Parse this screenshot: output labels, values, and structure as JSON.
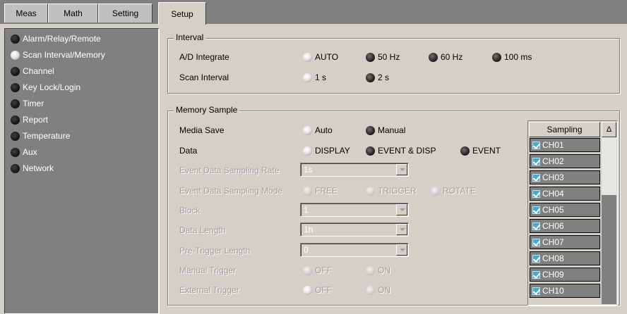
{
  "tabs": [
    {
      "label": "Meas"
    },
    {
      "label": "Math"
    },
    {
      "label": "Setting"
    },
    {
      "label": "Setup",
      "active": true
    }
  ],
  "nav": {
    "items": [
      {
        "label": "Alarm/Relay/Remote",
        "selected": false
      },
      {
        "label": "Scan Interval/Memory",
        "selected": true
      },
      {
        "label": "Channel",
        "selected": false
      },
      {
        "label": "Key Lock/Login",
        "selected": false
      },
      {
        "label": "Timer",
        "selected": false
      },
      {
        "label": "Report",
        "selected": false
      },
      {
        "label": "Temperature",
        "selected": false
      },
      {
        "label": "Aux",
        "selected": false
      },
      {
        "label": "Network",
        "selected": false
      }
    ]
  },
  "interval": {
    "title": "Interval",
    "ad_integrate": {
      "label": "A/D Integrate",
      "options": [
        "AUTO",
        "50 Hz",
        "60 Hz",
        "100 ms"
      ],
      "selected": "AUTO"
    },
    "scan_interval": {
      "label": "Scan Interval",
      "options": [
        "1 s",
        "2 s"
      ],
      "selected": "1 s"
    }
  },
  "memory": {
    "title": "Memory Sample",
    "media_save": {
      "label": "Media Save",
      "options": [
        "Auto",
        "Manual"
      ],
      "selected": "Auto"
    },
    "data": {
      "label": "Data",
      "options": [
        "DISPLAY",
        "EVENT & DISP",
        "EVENT"
      ],
      "selected": "DISPLAY"
    },
    "event_rate": {
      "label": "Event Data Sampling Rate",
      "value": "1s"
    },
    "event_mode": {
      "label": "Event Data Sampling Mode",
      "options": [
        "FREE",
        "TRIGGER",
        "ROTATE"
      ]
    },
    "block": {
      "label": "Block",
      "value": "1"
    },
    "data_length": {
      "label": "Data Length",
      "value": "1h"
    },
    "pre_trigger": {
      "label": "Pre-Trigger Length",
      "value": "0"
    },
    "manual_trigger": {
      "label": "Manual Trigger",
      "options": [
        "OFF",
        "ON"
      ]
    },
    "external_trigger": {
      "label": "External Trigger",
      "options": [
        "OFF",
        "ON"
      ],
      "selected": "OFF"
    }
  },
  "sampling": {
    "header": "Sampling",
    "scroll_up": "Δ",
    "channels": [
      "CH01",
      "CH02",
      "CH03",
      "CH04",
      "CH05",
      "CH06",
      "CH07",
      "CH08",
      "CH09",
      "CH10"
    ]
  }
}
